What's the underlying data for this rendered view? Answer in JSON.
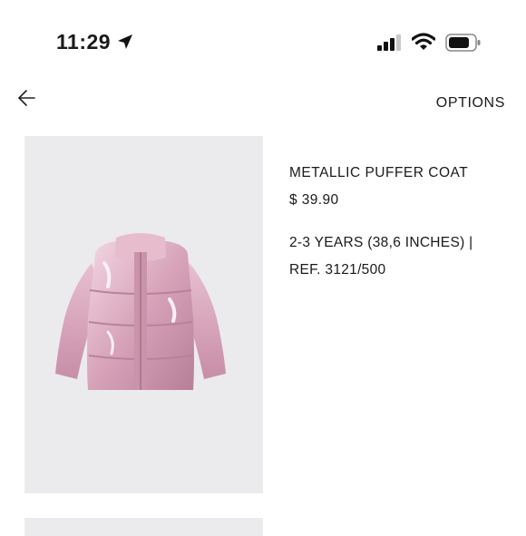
{
  "status_bar": {
    "time": "11:29",
    "icons": [
      "location-arrow-icon",
      "cellular-signal-icon",
      "wifi-icon",
      "battery-icon"
    ]
  },
  "nav": {
    "back_icon": "back-arrow-icon",
    "options_label": "OPTIONS"
  },
  "product": {
    "name": "METALLIC PUFFER COAT",
    "price": "$ 39.90",
    "size": "2-3 YEARS (38,6 INCHES) |",
    "ref": "REF. 3121/500",
    "image_alt": "pink metallic puffer jacket",
    "colors": {
      "coat": "#d9a9bd",
      "background": "#ebebed"
    }
  }
}
